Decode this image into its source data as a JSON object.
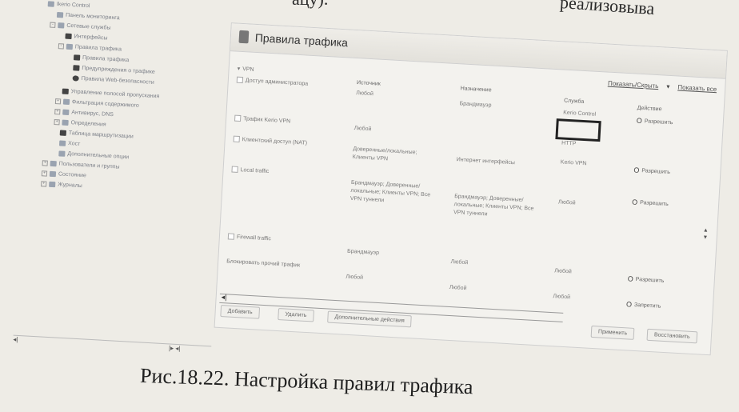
{
  "book": {
    "top_left": "ацу).",
    "top_right": "реализовыва"
  },
  "tree": {
    "items": [
      {
        "label": "Ikerio Control",
        "icon": "app-icon"
      },
      {
        "label": "Панель мониторинга",
        "icon": "dashboard-icon"
      },
      {
        "label": "Сетевые службы",
        "icon": "folder-icon"
      },
      {
        "label": "Интерфейсы",
        "icon": "network-icon"
      },
      {
        "label": "Правила трафика",
        "icon": "folder-icon"
      },
      {
        "label": "Правила трафика",
        "icon": "rules-icon"
      },
      {
        "label": "Предупреждения о трафике",
        "icon": "rules-icon"
      },
      {
        "label": "Правила Web-безопасности",
        "icon": "circle-icon"
      },
      {
        "label": "Управление полосой пропускания",
        "icon": "bandwidth-icon"
      },
      {
        "label": "Фильтрация содержимого",
        "icon": "folder-icon"
      },
      {
        "label": "Антивирус, DNS",
        "icon": "folder-icon"
      },
      {
        "label": "Определения",
        "icon": "folder-icon"
      },
      {
        "label": "Таблица маршрутизации",
        "icon": "table-icon"
      },
      {
        "label": "Хост",
        "icon": "host-icon"
      },
      {
        "label": "Дополнительные опции",
        "icon": "options-icon"
      },
      {
        "label": "Пользователи и группы",
        "icon": "users-icon"
      },
      {
        "label": "Состояние",
        "icon": "status-icon"
      },
      {
        "label": "Журналы",
        "icon": "logs-icon"
      }
    ]
  },
  "panel": {
    "title": "Правила трафика",
    "links": {
      "show_default": "Показать/Скрыть",
      "filter": "Фильтр",
      "show_all": "Показать все"
    },
    "columns": {
      "source": "Источник",
      "destination": "Назначение",
      "service": "Служба",
      "action": "Действие"
    },
    "rows": [
      {
        "name": "VPN",
        "source": "",
        "destination": "",
        "service": "",
        "action": ""
      },
      {
        "name": "Доступ администратора",
        "source": "Любой",
        "destination": "Брандмауэр",
        "service": "Kerio Control",
        "action": "Разрешить"
      },
      {
        "name": "Трафик Kerio VPN",
        "source": "Любой",
        "destination": "",
        "service": "HTTP",
        "action": "Разрешить"
      },
      {
        "name": "Клиентский доступ (NAT)",
        "source": "Доверенные/локальные; Клиенты VPN",
        "destination": "Интернет интерфейсы",
        "service": "Kerio VPN",
        "action": "Разрешить"
      },
      {
        "name": "Local traffic",
        "source": "Брандмауэр; Доверенные/локальные; Клиенты VPN; Все VPN туннели",
        "destination": "Брандмауэр; Доверенные/локальные; Клиенты VPN; Все VPN туннели",
        "service": "Любой",
        "action": "Разрешить"
      },
      {
        "name": "Firewall traffic",
        "source": "Брандмауэр",
        "destination": "Любой",
        "service": "Любой",
        "action": "Разрешить"
      },
      {
        "name": "Блокировать прочий трафик",
        "source": "Любой",
        "destination": "Любой",
        "service": "Любой",
        "action": "Запретить"
      }
    ],
    "buttons": {
      "add": "Добавить",
      "delete": "Удалить",
      "more": "Дополнительные действия",
      "apply": "Применить",
      "cancel": "Восстановить"
    }
  },
  "caption": "Рис.18.22. Настройка правил трафика"
}
